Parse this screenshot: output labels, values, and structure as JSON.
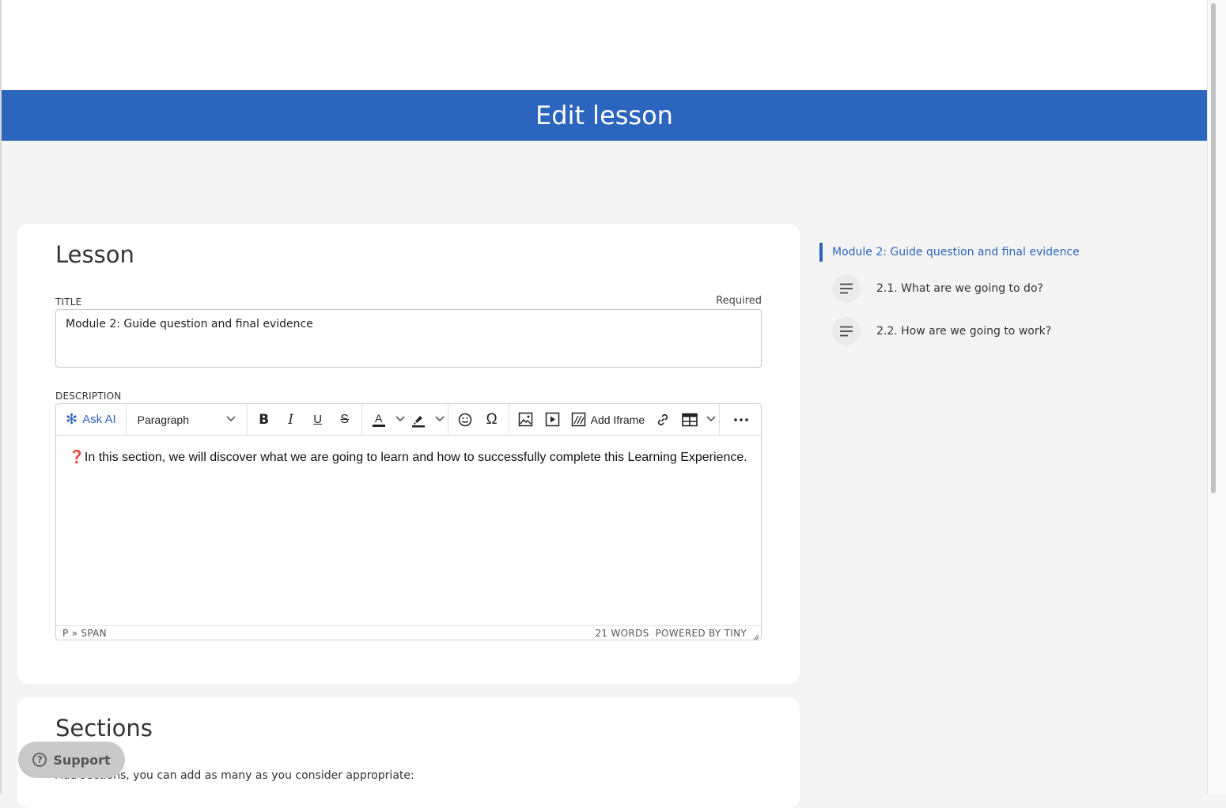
{
  "header": {
    "title": "Edit lesson"
  },
  "lesson_card": {
    "heading": "Lesson",
    "title_field": {
      "label": "TITLE",
      "required": "Required",
      "value": "Module 2: Guide question and final evidence"
    },
    "description_field": {
      "label": "DESCRIPTION",
      "toolbar": {
        "ask_ai": "Ask AI",
        "block_format": "Paragraph",
        "add_iframe": "Add Iframe"
      },
      "content": "In this section, we will discover what we are going to learn and how to successfully complete this Learning Experience.",
      "status_path": "P » SPAN",
      "word_count": "21 WORDS",
      "powered_by": "POWERED BY TINY"
    }
  },
  "sections_card": {
    "heading": "Sections",
    "help": "Add sections, you can add as many as you consider appropriate:"
  },
  "outline": {
    "current": "Module 2: Guide question and final evidence",
    "items": [
      {
        "label": "2.1. What are we going to do?",
        "icon": "lines-icon"
      },
      {
        "label": "2.2. How are we going to work?",
        "icon": "lines-icon"
      }
    ]
  },
  "support": {
    "label": "Support"
  },
  "colors": {
    "brand": "#2c65bd",
    "support_bg": "#c9c9c9"
  }
}
